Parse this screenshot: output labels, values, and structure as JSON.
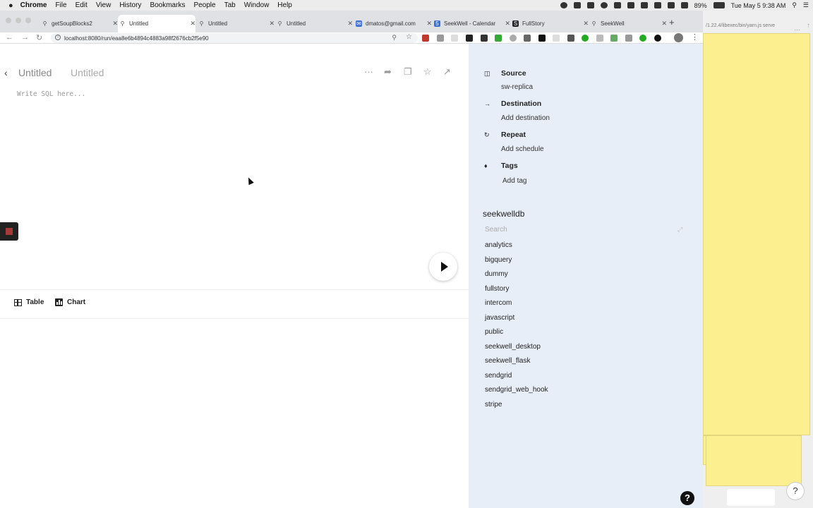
{
  "menubar": {
    "app": "Chrome",
    "items": [
      "File",
      "Edit",
      "View",
      "History",
      "Bookmarks",
      "People",
      "Tab",
      "Window",
      "Help"
    ],
    "battery": "89%",
    "clock": "Tue May 5  9:38 AM"
  },
  "tabs": [
    {
      "label": "getSoupBlocks2",
      "icon": "search-icon"
    },
    {
      "label": "Untitled",
      "icon": "search-icon",
      "active": true
    },
    {
      "label": "Untitled",
      "icon": "search-icon"
    },
    {
      "label": "Untitled",
      "icon": "search-icon"
    },
    {
      "label": "dmatos@gmail.com",
      "icon": "mail-icon"
    },
    {
      "label": "SeekWell - Calendar",
      "icon": "calendar-icon"
    },
    {
      "label": "FullStory",
      "icon": "fullstory-icon"
    },
    {
      "label": "SeekWell",
      "icon": "search-icon"
    }
  ],
  "browser": {
    "url": "localhost:8080/run/eaa8e6b4894c4883a98f2676cb2f5e90",
    "terminal_path": "/1.22.4/libexec/bin/yarn.js serve"
  },
  "editor": {
    "title": "Untitled",
    "subtitle": "Untitled",
    "sql_placeholder": "Write SQL here...",
    "view_tabs": {
      "table": "Table",
      "chart": "Chart"
    }
  },
  "sidebar": {
    "source": {
      "heading": "Source",
      "value": "sw-replica"
    },
    "destination": {
      "heading": "Destination",
      "value": "Add destination"
    },
    "repeat": {
      "heading": "Repeat",
      "value": "Add schedule"
    },
    "tags": {
      "heading": "Tags",
      "value": "Add tag"
    },
    "db": {
      "name": "seekwelldb",
      "search_placeholder": "Search",
      "schemas": [
        "analytics",
        "bigquery",
        "dummy",
        "fullstory",
        "intercom",
        "javascript",
        "public",
        "seekwell_desktop",
        "seekwell_flask",
        "sendgrid",
        "sendgrid_web_hook",
        "stripe"
      ]
    },
    "help": "?"
  }
}
